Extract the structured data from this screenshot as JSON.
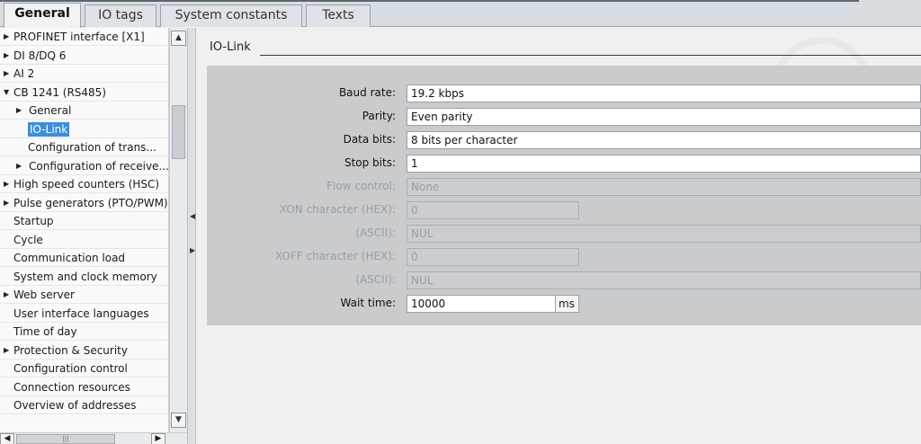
{
  "tabs": [
    {
      "label": "General",
      "active": true
    },
    {
      "label": "IO tags",
      "active": false
    },
    {
      "label": "System constants",
      "active": false
    },
    {
      "label": "Texts",
      "active": false
    }
  ],
  "tree": [
    {
      "label": "PROFINET interface [X1]",
      "expander": "collapsed",
      "indent": 0
    },
    {
      "label": "DI 8/DQ 6",
      "expander": "collapsed",
      "indent": 0
    },
    {
      "label": "AI 2",
      "expander": "collapsed",
      "indent": 0
    },
    {
      "label": "CB 1241 (RS485)",
      "expander": "expanded",
      "indent": 0
    },
    {
      "label": "General",
      "expander": "collapsed",
      "indent": 1
    },
    {
      "label": "IO-Link",
      "expander": "none",
      "indent": 1,
      "selected": true
    },
    {
      "label": "Configuration of trans...",
      "expander": "none",
      "indent": 1
    },
    {
      "label": "Configuration of receive...",
      "expander": "collapsed",
      "indent": 1
    },
    {
      "label": "High speed counters (HSC)",
      "expander": "collapsed",
      "indent": 0
    },
    {
      "label": "Pulse generators (PTO/PWM)",
      "expander": "collapsed",
      "indent": 0
    },
    {
      "label": "Startup",
      "expander": "none",
      "indent": 0
    },
    {
      "label": "Cycle",
      "expander": "none",
      "indent": 0
    },
    {
      "label": "Communication load",
      "expander": "none",
      "indent": 0
    },
    {
      "label": "System and clock memory",
      "expander": "none",
      "indent": 0
    },
    {
      "label": "Web server",
      "expander": "collapsed",
      "indent": 0
    },
    {
      "label": "User interface languages",
      "expander": "none",
      "indent": 0
    },
    {
      "label": "Time of day",
      "expander": "none",
      "indent": 0
    },
    {
      "label": "Protection & Security",
      "expander": "collapsed",
      "indent": 0
    },
    {
      "label": "Configuration control",
      "expander": "none",
      "indent": 0
    },
    {
      "label": "Connection resources",
      "expander": "none",
      "indent": 0
    },
    {
      "label": "Overview of addresses",
      "expander": "none",
      "indent": 0
    }
  ],
  "section": {
    "title": "IO-Link"
  },
  "form": {
    "baud_rate": {
      "label": "Baud rate:",
      "value": "19.2 kbps"
    },
    "parity": {
      "label": "Parity:",
      "value": "Even parity"
    },
    "data_bits": {
      "label": "Data bits:",
      "value": "8 bits per character"
    },
    "stop_bits": {
      "label": "Stop bits:",
      "value": "1"
    },
    "flow_control": {
      "label": "Flow control:",
      "value": "None"
    },
    "xon_hex": {
      "label": "XON character (HEX):",
      "value": "0"
    },
    "xon_ascii": {
      "label": "(ASCII):",
      "value": "NUL"
    },
    "xoff_hex": {
      "label": "XOFF character (HEX):",
      "value": "0"
    },
    "xoff_ascii": {
      "label": "(ASCII):",
      "value": "NUL"
    },
    "wait_time": {
      "label": "Wait time:",
      "value": "10000",
      "unit": "ms"
    }
  }
}
